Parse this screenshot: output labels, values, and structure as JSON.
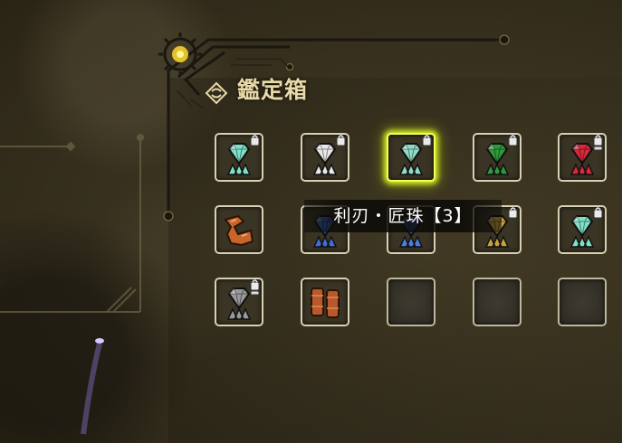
{
  "title": "鑑定箱",
  "tooltip": "利刃・匠珠【3】",
  "colors": {
    "accent_glow": "#f2ff55",
    "title_text": "#e9d9a6",
    "slot_border": "#d8d0b4"
  },
  "slots": [
    {
      "row": 1,
      "col": 1,
      "item": "teal-gem-icon",
      "gem_color": "#7fe0c8",
      "badge": "lock"
    },
    {
      "row": 1,
      "col": 2,
      "item": "white-gem-icon",
      "gem_color": "#e8e8e8",
      "badge": "lock"
    },
    {
      "row": 1,
      "col": 3,
      "item": "teal-gem-icon",
      "gem_color": "#8fdcc6",
      "badge": "lock",
      "selected": true
    },
    {
      "row": 1,
      "col": 4,
      "item": "green-gem-icon",
      "gem_color": "#2f9a3a",
      "badge": "lock"
    },
    {
      "row": 1,
      "col": 5,
      "item": "red-gem-icon",
      "gem_color": "#d8283a",
      "badge": "lock-stacked"
    },
    {
      "row": 2,
      "col": 1,
      "item": "copper-scrap-icon",
      "gem_color": "#c7652a"
    },
    {
      "row": 2,
      "col": 2,
      "item": "blue-gem-icon",
      "gem_color": "#3f6ed8"
    },
    {
      "row": 2,
      "col": 3,
      "item": "blue-gem-icon",
      "gem_color": "#4a7fe0"
    },
    {
      "row": 2,
      "col": 4,
      "item": "gold-gem-icon",
      "gem_color": "#c9a23a",
      "badge": "lock"
    },
    {
      "row": 2,
      "col": 5,
      "item": "teal-gem-icon",
      "gem_color": "#7fe0c8",
      "badge": "lock"
    },
    {
      "row": 3,
      "col": 1,
      "item": "gray-gem-icon",
      "gem_color": "#9a9a9a",
      "badge": "lock-stacked"
    },
    {
      "row": 3,
      "col": 2,
      "item": "leather-greaves-icon",
      "gem_color": "#b8582c"
    },
    {
      "row": 3,
      "col": 3,
      "item": "empty"
    },
    {
      "row": 3,
      "col": 4,
      "item": "empty"
    },
    {
      "row": 3,
      "col": 5,
      "item": "empty"
    }
  ]
}
